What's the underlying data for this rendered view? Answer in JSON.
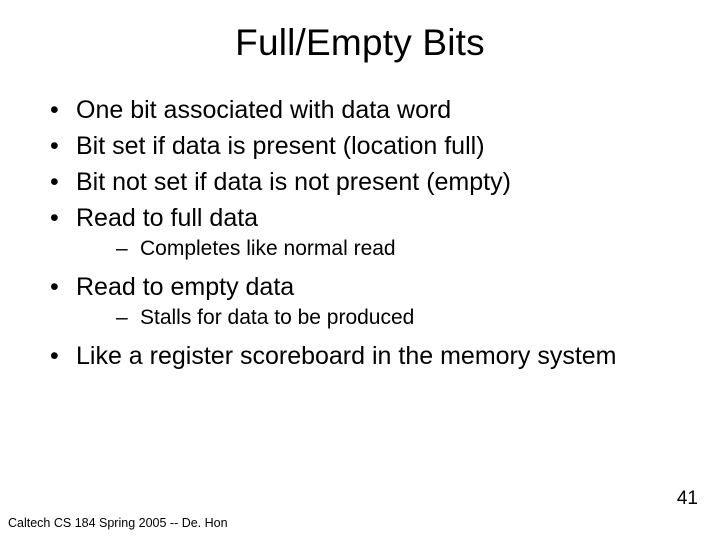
{
  "slide": {
    "title": "Full/Empty Bits",
    "bullets": [
      {
        "text": "One bit associated with data word",
        "sub": []
      },
      {
        "text": "Bit set if data is present (location full)",
        "sub": []
      },
      {
        "text": "Bit not set if data is not present (empty)",
        "sub": []
      },
      {
        "text": "Read to full data",
        "sub": [
          "Completes like normal read"
        ]
      },
      {
        "text": "Read to empty data",
        "sub": [
          "Stalls for data to be produced"
        ]
      },
      {
        "text": "Like a register scoreboard in the memory system",
        "sub": []
      }
    ],
    "footer": "Caltech CS 184 Spring 2005 -- De. Hon",
    "page_number": "41"
  }
}
